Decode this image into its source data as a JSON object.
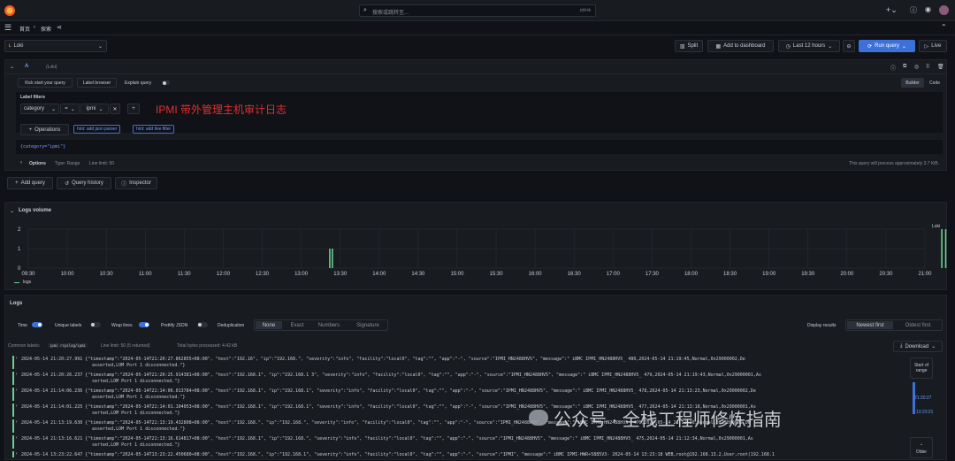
{
  "topbar": {
    "search_placeholder": "搜索或跳转至...",
    "shortcut": "ctrl+k"
  },
  "breadcrumb": {
    "home": "首页",
    "separator": "›",
    "explore": "探索"
  },
  "explore_bar": {
    "datasource": "Loki",
    "split": "Split",
    "add_to_dashboard": "Add to dashboard",
    "time_range": "Last 12 hours",
    "run_query": "Run query",
    "live": "Live"
  },
  "query": {
    "ref_id": "A",
    "datasource_tag": "(Loki)",
    "kick_start": "Kick start your query",
    "label_browser": "Label browser",
    "explain_query": "Explain query",
    "builder": "Builder",
    "code": "Code",
    "label_filters_title": "Label filters",
    "filter_label": "category",
    "filter_op": "=",
    "filter_value": "ipmi",
    "annotation": "IPMI 带外管理主机审计日志",
    "operations": "Operations",
    "hint1": "hint: add json parser",
    "hint2": "hint: add line filter",
    "expression": "{category=\"ipmi\"}",
    "options_label": "Options",
    "options_type": "Type: Range",
    "options_limit": "Line limit: 50",
    "process_note": "This query will process approximately 3.7 KiB."
  },
  "actions": {
    "add_query": "Add query",
    "query_history": "Query history",
    "inspector": "Inspector"
  },
  "volume": {
    "title": "Logs volume",
    "legend": "logs",
    "series_label": "Loki"
  },
  "chart_data": {
    "type": "bar",
    "title": "Logs volume",
    "x_ticks": [
      "09:30",
      "10:00",
      "10:30",
      "11:00",
      "11:30",
      "12:00",
      "12:30",
      "13:00",
      "13:30",
      "14:00",
      "14:30",
      "15:00",
      "15:30",
      "16:00",
      "16:30",
      "17:00",
      "17:30",
      "18:00",
      "18:30",
      "19:00",
      "19:30",
      "20:00",
      "20:30",
      "21:00"
    ],
    "y_ticks": [
      0,
      1,
      2
    ],
    "ylim": [
      0,
      2
    ],
    "series": [
      {
        "name": "logs",
        "color": "#6ccf8e",
        "points": [
          {
            "x": "13:22",
            "y": 1
          },
          {
            "x": "13:24",
            "y": 1
          },
          {
            "x": "21:13",
            "y": 2
          },
          {
            "x": "21:16",
            "y": 2
          }
        ]
      }
    ]
  },
  "logs": {
    "title": "Logs",
    "time": "Time",
    "unique_labels": "Unique labels",
    "wrap_lines": "Wrap lines",
    "prettify_json": "Prettify JSON",
    "dedup_label": "Deduplication",
    "dedup_options": [
      "None",
      "Exact",
      "Numbers",
      "Signature"
    ],
    "display_results": "Display results",
    "newest_first": "Newest first",
    "oldest_first": "Oldest first",
    "common_labels": "Common labels:",
    "common_label_values": "ipmi  rsyslog/ipmi",
    "line_limit": "Line limit: 50 (5 returned)",
    "bytes_processed": "Total bytes processed: 4.42 kB",
    "download": "Download",
    "start_of_range": "Start of range",
    "range_time_1": "21:20:27",
    "range_time_2": "13:23:21",
    "older": "Older",
    "rows": [
      {
        "line1": "2024-05-14 21:20:27.991 {\"timestamp\":\"2024-05-14T21:20:27.862855+08:00\", \"host\":\"192.16\",  \"ip\":\"192.168.\",  \"severity\":\"info\", \"facility\":\"local0\", \"tag\":\"\", \"app\":\"-\", \"source\":\"IPMI_HN2488HV5\",   \"message\":\" iBMC IPMI_HN2488HV5_    480,2024-05-14 21:19:45,Normal,0x29000002,De",
        "line2": "asserted,LOM Port 1 disconnected.\"}"
      },
      {
        "line1": "2024-05-14 21:20:26.237 {\"timestamp\":\"2024-05-14T21:20:25.914381+08:00\", \"host\":\"192.168.1\",  \"ip\":\"192.168.1   3\", \"severity\":\"info\", \"facility\":\"local0\", \"tag\":\"\", \"app\":\"-\", \"source\":\"IPMI_HN2488HV5\",   \"message\":\" iBMC IPMI_HN2488HV5_    479,2024-05-14 21:19:43,Normal,0x29000001,As",
        "line2": "serted,LOM Port 1 disconnected.\"}"
      },
      {
        "line1": "2024-05-14 21:14:06.236 {\"timestamp\":\"2024-05-14T21:14:06.013784+08:00\", \"host\":\"192.168.1\",  \"ip\":\"192.168.1\",  \"severity\":\"info\", \"facility\":\"local0\", \"tag\":\"\", \"app\":\"-\", \"source\":\"IPMI_HN2488HV5\",   \"message\":\" iBMC IPMI_HN2488HV5_    478,2024-05-14 21:13:23,Normal,0x29000002,De",
        "line2": "asserted,LOM Port 1 disconnected.\"}"
      },
      {
        "line1": "2024-05-14 21:14:01.225 {\"timestamp\":\"2024-05-14T21:14:01.104053+08:00\", \"host\":\"192.168.1\",  \"ip\":\"192.168.1\",  \"severity\":\"info\", \"facility\":\"local0\", \"tag\":\"\", \"app\":\"-\", \"source\":\"IPMI_HN2488HV5\",   \"message\":\" iBMC IPMI_HN2488HV5_    477,2024-05-14 21:13:18,Normal,0x29000001,As",
        "line2": "serted,LOM Port 1 disconnected.\"}"
      },
      {
        "line1": "2024-05-14 21:13:19.630 {\"timestamp\":\"2024-05-14T21:13:19.432808+08:00\", \"host\":\"192.168.\",  \"ip\":\"192.168.\",  \"severity\":\"info\", \"facility\":\"local0\", \"tag\":\"\", \"app\":\"-\", \"source\":\"IPMI_HN2488HV5\",   \"message\":\" iBMC IPMI_HN2488HV5_    476,2024-05-14 21:12:36,Normal,0x29000002,De",
        "line2": "asserted,LOM Port 1 disconnected.\"}"
      },
      {
        "line1": "2024-05-14 21:13:16.621 {\"timestamp\":\"2024-05-14T21:13:16.614817+08:00\", \"host\":\"192.168.1\",  \"ip\":\"192.168.\",  \"severity\":\"info\", \"facility\":\"local0\", \"tag\":\"\", \"app\":\"-\", \"source\":\"IPMI_HN2488HV5\",   \"message\":\" iBMC IPMI_HN2488HV5_    475,2024-05-14 21:12:34,Normal,0x29000001,As",
        "line2": "serted,LOM Port 1 disconnected.\"}"
      },
      {
        "line1": "2024-05-14 13:23:22.647 {\"timestamp\":\"2024-05-14T13:23:22.450680+08:00\", \"host\":\"192.168.\",  \"ip\":\"192.168.1\",  \"severity\":\"info\", \"facility\":\"local0\", \"tag\":\"\", \"app\":\"-\", \"source\":\"IPMI\", \"message\":\" iBMC IPMI-HWR+5885V3-  2024-05-14 13:23:18 WEB,root@192.168.13.2,User,root(192.168.1",
        "line2": ""
      }
    ]
  },
  "watermark": "公众号 · 全栈工程师修炼指南"
}
